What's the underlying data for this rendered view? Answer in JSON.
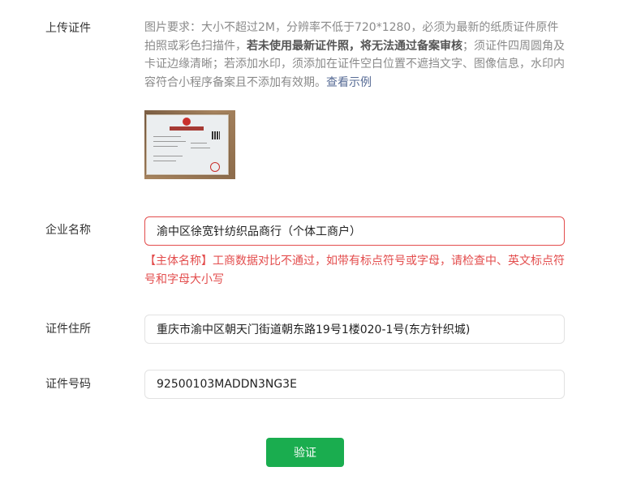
{
  "upload": {
    "label": "上传证件",
    "hint_part1": "图片要求：大小不超过2M，分辨率不低于720*1280，必须为最新的纸质证件原件拍照或彩色扫描件，",
    "hint_bold": "若未使用最新证件照，将无法通过备案审核",
    "hint_part2": "；须证件四周圆角及卡证边缘清晰；若添加水印，须添加在证件空白位置不遮挡文字、图像信息，水印内容符合小程序备案且不添加有效期。",
    "example_link": "查看示例"
  },
  "company": {
    "label": "企业名称",
    "value": "渝中区徐宽针纺织品商行（个体工商户）",
    "error": "【主体名称】工商数据对比不通过，如带有标点符号或字母，请检查中、英文标点符号和字母大小写"
  },
  "address": {
    "label": "证件住所",
    "value": "重庆市渝中区朝天门街道朝东路19号1楼020-1号(东方针织城)"
  },
  "cert_number": {
    "label": "证件号码",
    "value": "92500103MADDN3NG3E"
  },
  "verify_button": {
    "label": "验证"
  },
  "colors": {
    "primary": "#1aad4f",
    "error": "#e34d4d",
    "link": "#576b95"
  }
}
